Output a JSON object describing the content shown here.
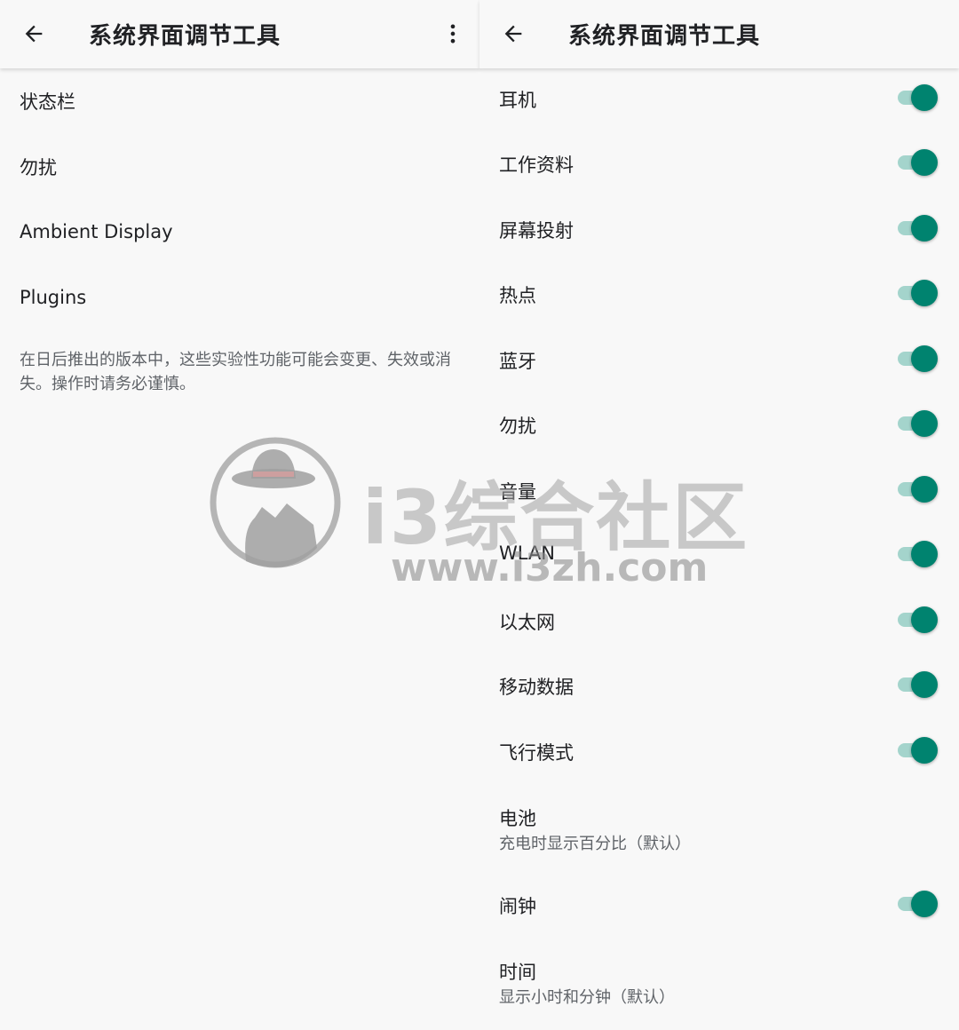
{
  "left_panel": {
    "title": "系统界面调节工具",
    "back_icon": "arrow-back-icon",
    "more_icon": "more-vert-icon",
    "menu_items": [
      {
        "label": "状态栏"
      },
      {
        "label": "勿扰"
      },
      {
        "label": "Ambient Display"
      },
      {
        "label": "Plugins"
      }
    ],
    "footer_note": "在日后推出的版本中，这些实验性功能可能会变更、失效或消失。操作时请务必谨慎。"
  },
  "right_panel": {
    "title": "系统界面调节工具",
    "back_icon": "arrow-back-icon",
    "rows": [
      {
        "label": "耳机",
        "toggle": true,
        "on": true
      },
      {
        "label": "工作资料",
        "toggle": true,
        "on": true
      },
      {
        "label": "屏幕投射",
        "toggle": true,
        "on": true
      },
      {
        "label": "热点",
        "toggle": true,
        "on": true
      },
      {
        "label": "蓝牙",
        "toggle": true,
        "on": true
      },
      {
        "label": "勿扰",
        "toggle": true,
        "on": true
      },
      {
        "label": "音量",
        "toggle": true,
        "on": true
      },
      {
        "label": "WLAN",
        "toggle": true,
        "on": true
      },
      {
        "label": "以太网",
        "toggle": true,
        "on": true
      },
      {
        "label": "移动数据",
        "toggle": true,
        "on": true
      },
      {
        "label": "飞行模式",
        "toggle": true,
        "on": true
      },
      {
        "label": "电池",
        "toggle": false,
        "subtitle": "充电时显示百分比（默认）"
      },
      {
        "label": "闹钟",
        "toggle": true,
        "on": true
      },
      {
        "label": "时间",
        "toggle": false,
        "subtitle": "显示小时和分钟（默认）"
      }
    ]
  },
  "watermark": {
    "title": "i3综合社区",
    "url": "www.i3zh.com"
  },
  "colors": {
    "background": "#f8f8f8",
    "switch_thumb": "#00836f",
    "switch_track": "#a4d4cc",
    "text_primary": "#202124",
    "text_secondary": "#5f6368"
  }
}
